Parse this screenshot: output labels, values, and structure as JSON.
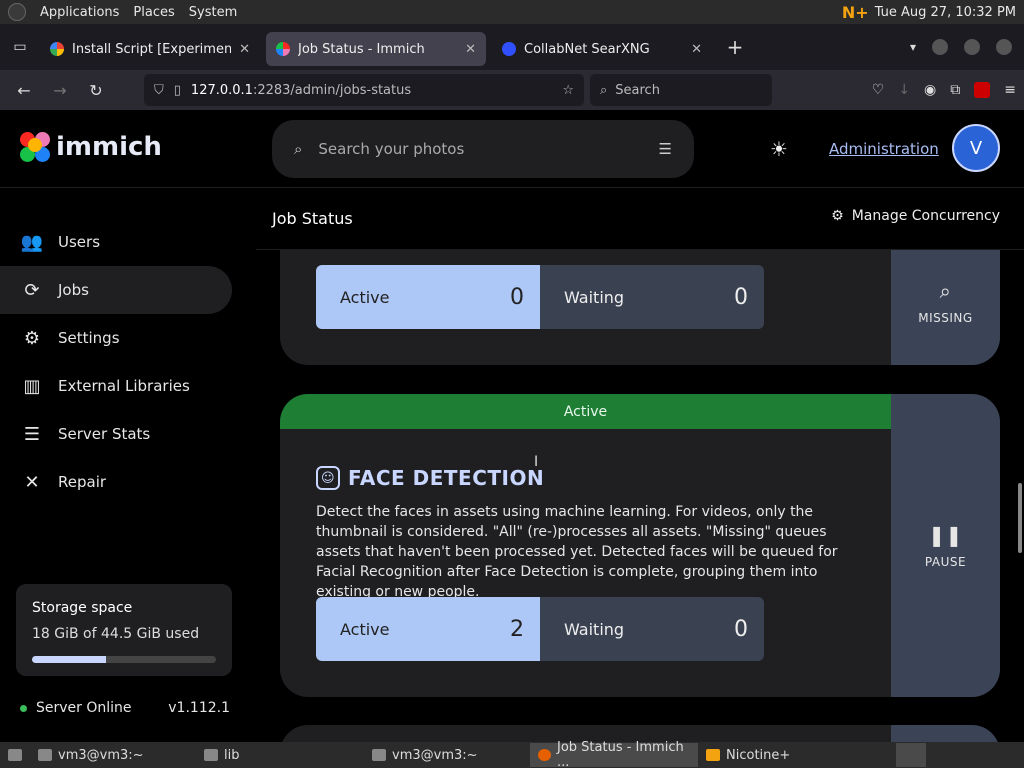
{
  "os_top": {
    "menus": [
      "Applications",
      "Places",
      "System"
    ],
    "clock": "Tue Aug 27, 10:32 PM"
  },
  "browser": {
    "tabs": [
      {
        "label": "Install Script [Experimental]",
        "active": false
      },
      {
        "label": "Job Status - Immich",
        "active": true
      },
      {
        "label": "CollabNet SearXNG",
        "active": false
      }
    ],
    "url_host": "127.0.0.1",
    "url_rest": ":2283/admin/jobs-status",
    "search_placeholder": "Search"
  },
  "app": {
    "brand": "immich",
    "search_placeholder": "Search your photos",
    "admin_link": "Administration",
    "avatar_initial": "V",
    "colors": {
      "accent": "#adc7f6",
      "status_active": "#1d7e34",
      "side_button": "#3b4356"
    }
  },
  "sidebar": {
    "items": [
      {
        "label": "Users",
        "icon": "users-icon"
      },
      {
        "label": "Jobs",
        "icon": "sync-icon"
      },
      {
        "label": "Settings",
        "icon": "gear-icon"
      },
      {
        "label": "External Libraries",
        "icon": "library-icon"
      },
      {
        "label": "Server Stats",
        "icon": "server-icon"
      },
      {
        "label": "Repair",
        "icon": "wrench-icon"
      }
    ],
    "storage": {
      "title": "Storage space",
      "used_text": "18 GiB of 44.5 GiB used",
      "used_fraction": 0.4
    },
    "server": {
      "status": "Server Online",
      "version": "v1.112.1"
    }
  },
  "main": {
    "title": "Job Status",
    "concurrency_label": "Manage Concurrency",
    "jobs": [
      {
        "active_label": "Active",
        "active_count": "0",
        "waiting_label": "Waiting",
        "waiting_count": "0",
        "button_label": "MISSING"
      },
      {
        "status": "Active",
        "title": "FACE DETECTION",
        "description": "Detect the faces in assets using machine learning. For videos, only the thumbnail is considered. \"All\" (re-)processes all assets. \"Missing\" queues assets that haven't been processed yet. Detected faces will be queued for Facial Recognition after Face Detection is complete, grouping them into existing or new people.",
        "active_label": "Active",
        "active_count": "2",
        "waiting_label": "Waiting",
        "waiting_count": "0",
        "button_label": "PAUSE"
      }
    ]
  },
  "taskbar": {
    "items": [
      {
        "label": "vm3@vm3:~"
      },
      {
        "label": "lib"
      },
      {
        "label": "vm3@vm3:~"
      },
      {
        "label": "Job Status - Immich ..."
      },
      {
        "label": "Nicotine+"
      }
    ]
  }
}
